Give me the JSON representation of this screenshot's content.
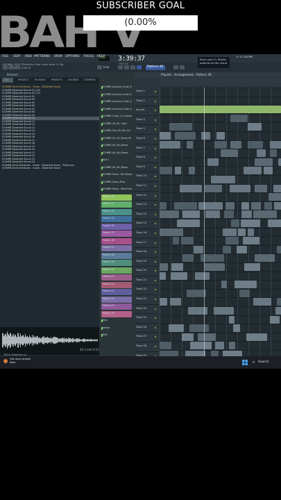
{
  "overlay": {
    "goal_title": "SUBSCRIBER GOAL",
    "goal_percent": "(0.00%",
    "goal_progress": 0.0,
    "ghost_text": "BAH V"
  },
  "menu": [
    "FILE",
    "EDIT",
    "ADD",
    "PATTERNS",
    "VIEW",
    "OPTIONS",
    "TOOLS",
    "HELP"
  ],
  "toolbar": {
    "song_info": "GLENBA CK19  @rats/de nillar more beat 11.flp",
    "song_info_2": "100.07.00  fst 4:38:00",
    "tempo": "150",
    "clock": "3:39:37",
    "clock_sub": "M:S:CS",
    "pattern": "Pattern 46",
    "save_tip": "Save your FL Studio projects to the cloud",
    "cpu": "21  4 128 MB",
    "line_label": "Line",
    "snap_label": "Stamp"
  },
  "browser": {
    "title": "Browser",
    "tabs": [
      "ALL",
      "PROJECT",
      "PLUGINS",
      "PRESETS",
      "SOUNDS",
      "STARRED"
    ],
    "files": [
      {
        "label": "ICONRR Drum Enhancer - Snare - Distorted Snare",
        "type": "folder"
      },
      {
        "label": "ICONRR Distorted Sound 01 (20)",
        "type": "file"
      },
      {
        "label": "ICONRR Distorted Sound 02 (21)",
        "type": "file"
      },
      {
        "label": "ICONRR Distorted Sound 03",
        "type": "file"
      },
      {
        "label": "ICONRR Distorted Sound 04",
        "type": "file"
      },
      {
        "label": "ICONRR Distorted Sound 05",
        "type": "file"
      },
      {
        "label": "ICONRR Distorted Sound 06",
        "type": "file"
      },
      {
        "label": "ICONRR Distorted Sound 07",
        "type": "file"
      },
      {
        "label": "ICONRR Distorted Sound 08",
        "type": "file"
      },
      {
        "label": "ICONRR Distorted Sound 09",
        "type": "file"
      },
      {
        "label": "ICONRR Distorted Sound 10",
        "type": "sel"
      },
      {
        "label": "ICONRR Distorted Sound 11",
        "type": "file"
      },
      {
        "label": "ICONRR Distorted Sound 12",
        "type": "file"
      },
      {
        "label": "ICONRR Distorted Sound 13",
        "type": "file"
      },
      {
        "label": "ICONRR Distorted Sound 14",
        "type": "file"
      },
      {
        "label": "ICONRR Distorted Sound 15",
        "type": "file"
      },
      {
        "label": "ICONRR Distorted Sound 16",
        "type": "file"
      },
      {
        "label": "ICONRR Distorted Sound 17",
        "type": "file"
      },
      {
        "label": "ICONRR Distorted Sound 18",
        "type": "file"
      },
      {
        "label": "ICONRR Distorted Sound 19",
        "type": "file"
      },
      {
        "label": "ICONRR Distorted Sound 20",
        "type": "file"
      },
      {
        "label": "ICONRR Distorted Sound 21",
        "type": "file"
      },
      {
        "label": "ICONRR Distorted Sound 22",
        "type": "file"
      },
      {
        "label": "ICONRR Distorted Sound 23",
        "type": "file"
      },
      {
        "label": "ICONRR Distorted Sound 24",
        "type": "file"
      },
      {
        "label": "ICONRR Drum Enhancer - Snare - Distorted Snare - Plate.wav",
        "type": "file"
      },
      {
        "label": "ICONRR Drum Enhancer - Snare - Distorted Snare",
        "type": "file"
      }
    ],
    "wave_label": "TAGS  distorted sn",
    "wave_time": "44.1 kHz 0:12"
  },
  "rack": [
    {
      "label": "ICONRR_Acoustic_Crash_01",
      "kind": "channel"
    },
    {
      "label": "ICONRR_Acoustic_Crash_02",
      "kind": "channel"
    },
    {
      "label": "ICONRR_Acoustic_Crash_03",
      "kind": "channel"
    },
    {
      "label": "ICONRR_Acoustic_Crash_04",
      "kind": "channel"
    },
    {
      "label": "ICONRR_Crash_11_Lowend",
      "kind": "channel"
    },
    {
      "label": "ICONRR_Hh_Sd - Faye",
      "kind": "channel"
    },
    {
      "label": "ICONRR_Sna_05_Vdr_Dry",
      "kind": "channel"
    },
    {
      "label": "ICONRR_Kic_05_Stomp Kir",
      "kind": "channel"
    },
    {
      "label": "ICONRR_Kic_06_Stomp",
      "kind": "channel"
    },
    {
      "label": "ICONRR_Kic_08_Stomp",
      "kind": "channel"
    },
    {
      "label": "Kick 1",
      "kind": "channel"
    },
    {
      "label": "ICONRR_Kic_08_Stomp",
      "kind": "channel"
    },
    {
      "label": "ICONRR Ghost - Kar Stomp",
      "kind": "channel"
    },
    {
      "label": "ICONRR_Snare_Ring",
      "kind": "channel"
    },
    {
      "label": "ICONRR Ghost - Wind Snare",
      "kind": "channel"
    },
    {
      "label": "Pattern 30",
      "kind": "pattern",
      "color": "#8fc55a"
    },
    {
      "label": "Pattern 31",
      "kind": "pattern",
      "color": "#5fae6a"
    },
    {
      "label": "Pattern 32",
      "kind": "pattern",
      "color": "#4a8f8a"
    },
    {
      "label": "Pattern 33",
      "kind": "pattern",
      "color": "#3f6f9a"
    },
    {
      "label": "Pattern 34",
      "kind": "pattern",
      "color": "#7060a8"
    },
    {
      "label": "Pattern 35",
      "kind": "pattern",
      "color": "#9a58a0"
    },
    {
      "label": "Pattern 36",
      "kind": "pattern",
      "color": "#a8508c"
    },
    {
      "label": "Pattern 37",
      "kind": "pattern",
      "color": "#7a6fa5"
    },
    {
      "label": "Pattern 38",
      "kind": "pattern",
      "color": "#5a7c9a"
    },
    {
      "label": "Pattern 39",
      "kind": "pattern",
      "color": "#4f8e7a"
    },
    {
      "label": "Pattern 40",
      "kind": "pattern",
      "color": "#6aa860"
    },
    {
      "label": "Pattern 41",
      "kind": "pattern",
      "color": "#9a5d8a"
    },
    {
      "label": "Pattern 42",
      "kind": "pattern",
      "color": "#a35a74"
    },
    {
      "label": "Pattern 43",
      "kind": "pattern",
      "color": "#5f5f9e"
    },
    {
      "label": "Pattern 44",
      "kind": "pattern",
      "color": "#7c6fa8"
    },
    {
      "label": "Pattern 45",
      "kind": "pattern",
      "color": "#8d5a9a"
    },
    {
      "label": "Pattern 46",
      "kind": "pattern",
      "color": "#b3608a"
    },
    {
      "label": "Disc",
      "kind": "channel"
    },
    {
      "label": "wahse",
      "kind": "channel"
    },
    {
      "label": "Disk",
      "kind": "channel"
    }
  ],
  "playlist": {
    "title": "Playlist - Arrangement › Pattern 46",
    "tracks": [
      "Track 1",
      "Track 2",
      "Acoust",
      "Track 4",
      "Track 5",
      "Track 6",
      "Track 7",
      "Track 8",
      "Track 9",
      "Track 10",
      "Track 11",
      "Track 12",
      "Track 13",
      "Track 14",
      "Track 15",
      "Track 16",
      "Track 17",
      "Track 18",
      "Track 19",
      "Track 20",
      "Track 21",
      "Track 22",
      "Track 23",
      "Track 24",
      "Track 25",
      "Track 26",
      "Track 27",
      "Track 28",
      "Track 29",
      "Track 30",
      "Track 31"
    ]
  },
  "taskbar": {
    "weather_1": "Hot days ahead",
    "weather_2": "Now",
    "search": "Search"
  }
}
